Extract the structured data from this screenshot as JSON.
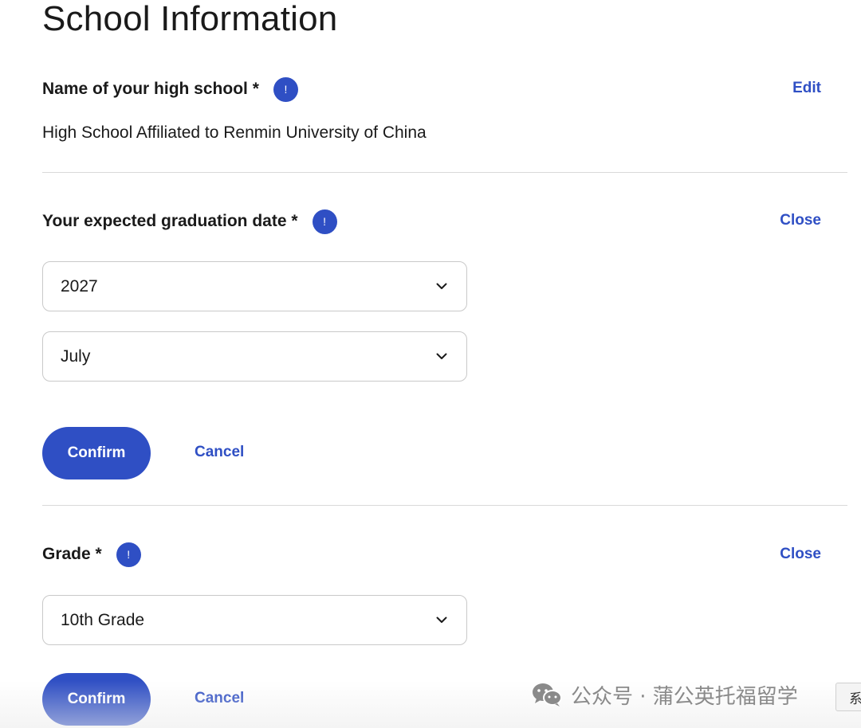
{
  "page": {
    "title": "School Information"
  },
  "high_school": {
    "label": "Name of your high school",
    "required_mark": "*",
    "info_icon": "!",
    "action": "Edit",
    "value": "High School Affiliated to Renmin University of China"
  },
  "graduation_date": {
    "label": "Your expected graduation date",
    "required_mark": "*",
    "info_icon": "!",
    "action": "Close",
    "year_select": "2027",
    "month_select": "July",
    "confirm_label": "Confirm",
    "cancel_label": "Cancel"
  },
  "grade": {
    "label": "Grade",
    "required_mark": "*",
    "info_icon": "!",
    "action": "Close",
    "grade_select": "10th Grade",
    "confirm_label": "Confirm",
    "cancel_label": "Cancel"
  },
  "overlay": {
    "watermark_text": "公众号 · 蒲公英托福留学",
    "side_tab_text": "系"
  },
  "colors": {
    "accent": "#2f4fc4",
    "text": "#1a1a1a",
    "divider": "#d9d9d9",
    "watermark": "#8a8a8a"
  },
  "icons": {
    "info": "info-icon",
    "dropdown": "chevron-down-icon",
    "watermark_logo": "wechat-icon"
  }
}
